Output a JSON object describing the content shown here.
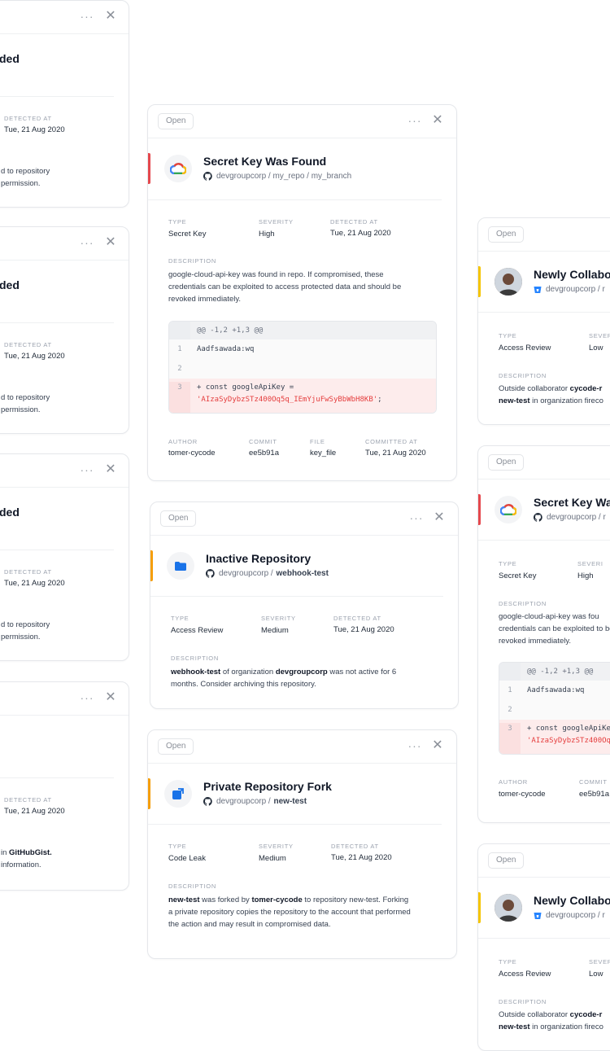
{
  "common": {
    "status": "Open",
    "more": "···",
    "close": "✕",
    "type_label": "TYPE",
    "severity_label": "SEVERITY",
    "detected_label": "DETECTED AT",
    "description_label": "DESCRIPTION",
    "author_label": "AUTHOR",
    "commit_label": "COMMIT",
    "file_label": "FILE",
    "committed_label": "COMMITTED AT",
    "date": "Tue, 21 Aug 2020",
    "severity_label_clipped": "SEVERI"
  },
  "colors": {
    "accent_red": "#e5484d",
    "accent_orange": "#f59e0b",
    "accent_yellow": "#f5c400",
    "brand_blue": "#1a73e8"
  },
  "left_column": {
    "title_fragment": "ded",
    "desc_line1_a": "d to repository",
    "desc_line2_a": " permission.",
    "desc_line1_b": " in ",
    "desc_line1_b_bold": "GitHubGist.",
    "desc_line2_b": " information."
  },
  "center_secret": {
    "title": "Secret Key Was Found",
    "path": "devgroupcorp / my_repo / my_branch",
    "type": "Secret Key",
    "severity": "High",
    "description": "google-cloud-api-key was found in repo. If compromised, these credentials can be exploited to access protected data and should be revoked immediately.",
    "diff_header": "@@ -1,2 +1,3 @@",
    "line1_num": "1",
    "line1_code": "Aadfsawada:wq",
    "line2_num": "2",
    "line3_num": "3",
    "line3_code": "+ const googleApiKey =",
    "line3_string": "'AIzaSyDybzSTz400Oq5q_IEmYjuFwSyBbWbH8KB'",
    "line3_end": ";",
    "author": "tomer-cycode",
    "commit": "ee5b91a",
    "file": "key_file"
  },
  "center_inactive": {
    "title": "Inactive Repository",
    "path_prefix": "devgroupcorp / ",
    "path_repo": "webhook-test",
    "type": "Access Review",
    "severity": "Medium",
    "desc_b1": "webhook-test",
    "desc_t1": " of organization ",
    "desc_b2": "devgroupcorp",
    "desc_t2": " was not active for 6 months. Consider archiving this repository."
  },
  "center_fork": {
    "title": "Private Repository Fork",
    "path_prefix": "devgroupcorp / ",
    "path_repo": "new-test",
    "type": "Code Leak",
    "severity": "Medium",
    "desc_b1": "new-test",
    "desc_t1": " was forked by ",
    "desc_b2": "tomer-cycode",
    "desc_t2": " to repository new-test. Forking a private repository copies the repository to the account that performed the action and may result in compromised data."
  },
  "right_column": {
    "collab_title": "Newly Collabo",
    "collab_path": "devgroupcorp / r",
    "collab_type": "Access Review",
    "collab_severity": "Low",
    "collab_desc1": "Outside collaborator ",
    "collab_desc1_bold": "cycode-r",
    "collab_desc2_bold": "new-test",
    "collab_desc2": " in organization fireco",
    "secret_title": "Secret Key Wa",
    "secret_path": "devgroupcorp / r",
    "secret_type": "Secret Key",
    "secret_severity": "High",
    "secret_desc": "google-cloud-api-key was fou credentials can be exploited to be revoked immediately.",
    "diff_header": "@@ -1,2 +1,3 @@",
    "line1_code": "Aadfsawada:wq",
    "line3_code": "+ const googleApiKe",
    "line3_string": "'AIzaSyDybzSTz400Oq",
    "author": "tomer-cycode",
    "commit": "ee5b91a"
  }
}
